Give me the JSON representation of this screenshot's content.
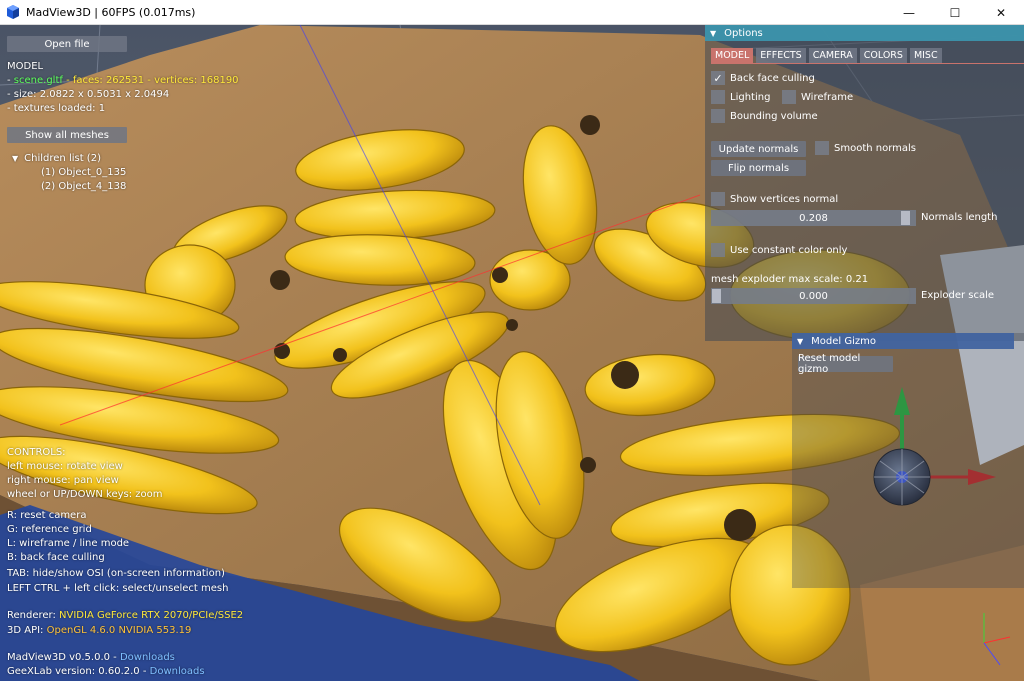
{
  "window": {
    "title": "MadView3D | 60FPS (0.017ms)",
    "minimize": "—",
    "maximize": "☐",
    "close": "✕"
  },
  "left": {
    "open_file": "Open file",
    "model_heading": "MODEL",
    "scene_prefix": "- ",
    "scene_name": "scene.gltf",
    "faces_text": "- faces: 262531 - vertices: 168190",
    "size_text": "- size:  2.0822 x 0.5031 x 2.0494",
    "textures_text": "- textures loaded: 1",
    "show_all_meshes": "Show all meshes",
    "children_label": "Children list (2)",
    "children": [
      "(1) Object_0_135",
      "(2) Object_4_138"
    ]
  },
  "controls": {
    "heading": "CONTROLS:",
    "lines": [
      "left mouse: rotate view",
      "right mouse: pan view",
      "wheel or UP/DOWN keys: zoom",
      "",
      "R: reset camera",
      "G: reference grid",
      "L: wireframe / line mode",
      "B: back face culling",
      "TAB: hide/show OSI (on-screen information)",
      "LEFT CTRL + left click: select/unselect mesh"
    ]
  },
  "info": {
    "renderer_label": "Renderer:",
    "renderer_value": "NVIDIA GeForce RTX 2070/PCIe/SSE2",
    "api_label": "3D API:",
    "api_value": "OpenGL 4.6.0 NVIDIA 553.19",
    "madview_version": "MadView3D v0.5.0.0",
    "geexlab_version": "GeeXLab version: 0.60.2.0",
    "separator": "-",
    "downloads": "Downloads"
  },
  "options": {
    "header": "Options",
    "tabs": [
      "MODEL",
      "EFFECTS",
      "CAMERA",
      "COLORS",
      "MISC"
    ],
    "active_tab": "MODEL",
    "back_face_culling": "Back face culling",
    "back_face_culling_checked": true,
    "lighting": "Lighting",
    "wireframe": "Wireframe",
    "bounding_volume": "Bounding volume",
    "update_normals": "Update normals",
    "smooth_normals": "Smooth normals",
    "flip_normals": "Flip normals",
    "show_vertices_normal": "Show vertices normal",
    "normals_length_value": "0.208",
    "normals_length_label": "Normals length",
    "normals_length_fraction": 0.97,
    "use_constant_color": "Use constant color only",
    "exploder_max_label": "mesh exploder max scale: 0.21",
    "exploder_value": "0.000",
    "exploder_label": "Exploder scale",
    "exploder_fraction": 0.0,
    "checkmark": "✓"
  },
  "gizmo": {
    "header": "Model Gizmo",
    "reset": "Reset model gizmo"
  },
  "icons": {
    "app": "app-cube-icon",
    "collapse": "triangle-down-icon"
  },
  "colors": {
    "accent_tab": "#c9736c",
    "options_header": "#3c94ac",
    "gizmo_header": "#4164a0"
  }
}
